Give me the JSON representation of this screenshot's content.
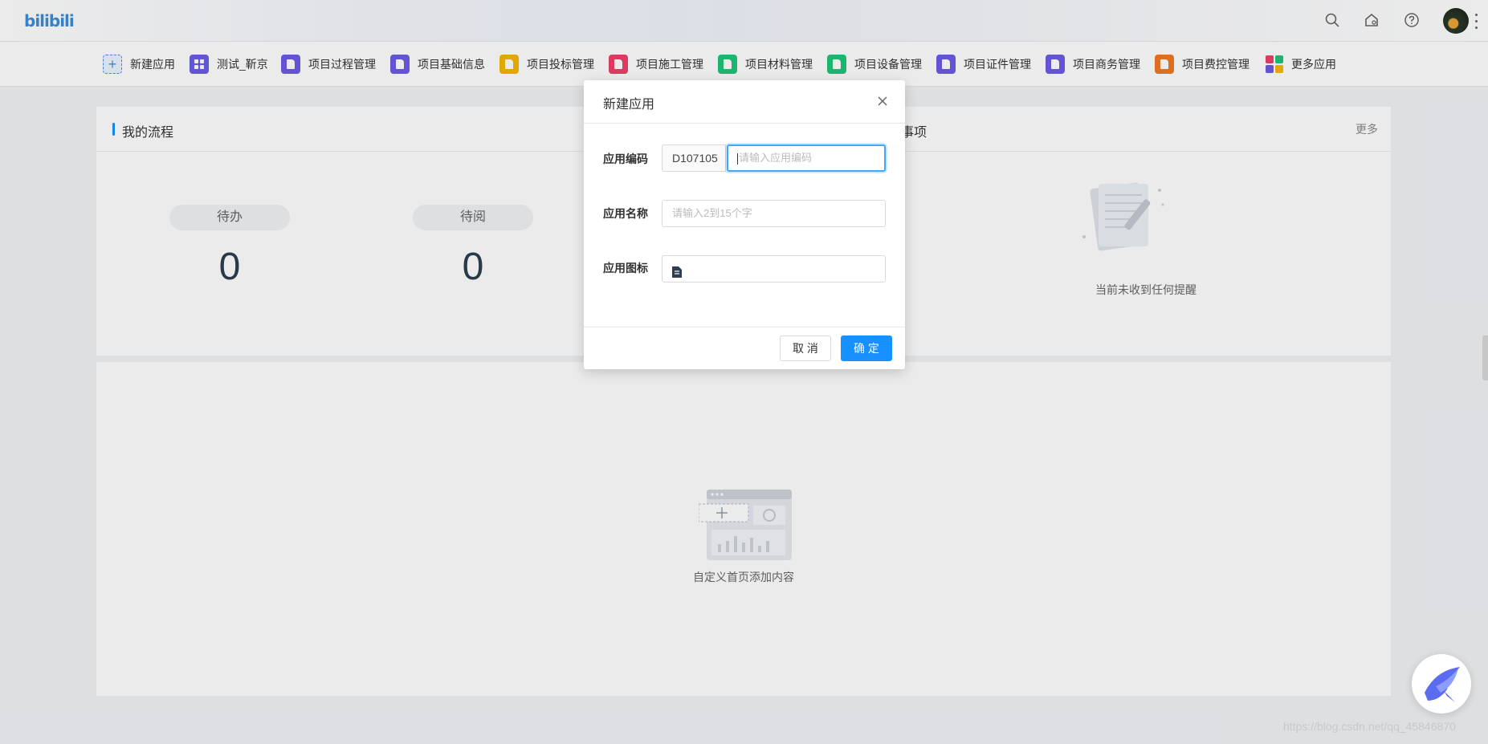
{
  "header": {
    "logo": "bilibili"
  },
  "apps": [
    {
      "label": "新建应用",
      "color": "#4a90e2",
      "icon": "plus-icon"
    },
    {
      "label": "测试_靳京",
      "color": "#6c5ce7",
      "icon": "grid-icon"
    },
    {
      "label": "项目过程管理",
      "color": "#6c5ce7",
      "icon": "doc-icon"
    },
    {
      "label": "项目基础信息",
      "color": "#6c5ce7",
      "icon": "doc-icon"
    },
    {
      "label": "项目投标管理",
      "color": "#f5b800",
      "icon": "doc-icon"
    },
    {
      "label": "项目施工管理",
      "color": "#ee3f6a",
      "icon": "doc-icon"
    },
    {
      "label": "项目材料管理",
      "color": "#1fc57a",
      "icon": "doc-icon"
    },
    {
      "label": "项目设备管理",
      "color": "#1fc57a",
      "icon": "doc-icon"
    },
    {
      "label": "项目证件管理",
      "color": "#6c5ce7",
      "icon": "doc-icon"
    },
    {
      "label": "项目商务管理",
      "color": "#6c5ce7",
      "icon": "doc-icon"
    },
    {
      "label": "项目费控管理",
      "color": "#f07a22",
      "icon": "doc-icon"
    },
    {
      "label": "更多应用",
      "color": "#ee3f6a",
      "icon": "apps-icon"
    }
  ],
  "workflow": {
    "title": "我的流程",
    "todo_label": "待办",
    "todo_count": "0",
    "read_label": "待阅",
    "read_count": "0"
  },
  "reminders": {
    "title_partial": "事项",
    "more": "更多",
    "empty": "当前未收到任何提醒"
  },
  "custom": {
    "empty": "自定义首页添加内容"
  },
  "modal": {
    "title": "新建应用",
    "code_label": "应用编码",
    "code_prefix": "D107105",
    "code_placeholder": "请输入应用编码",
    "name_label": "应用名称",
    "name_placeholder": "请输入2到15个字",
    "icon_label": "应用图标",
    "cancel": "取 消",
    "ok": "确 定"
  },
  "watermark": "https://blog.csdn.net/qq_45846870"
}
